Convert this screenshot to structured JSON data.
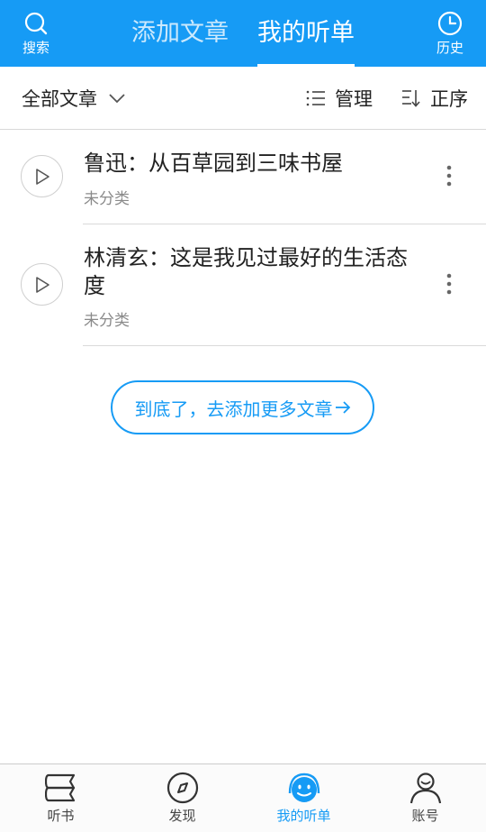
{
  "colors": {
    "brand": "#169bf5",
    "text": "#222222",
    "muted": "#8a8a8a",
    "divider": "#d9d9d9"
  },
  "header": {
    "search": {
      "label": "搜索",
      "icon": "search-icon"
    },
    "history": {
      "label": "历史",
      "icon": "clock-icon"
    },
    "tabs": [
      {
        "label": "添加文章",
        "active": false
      },
      {
        "label": "我的听单",
        "active": true
      }
    ]
  },
  "toolbar": {
    "filter_label": "全部文章",
    "manage_label": "管理",
    "order_label": "正序"
  },
  "articles": [
    {
      "title": "鲁迅：从百草园到三味书屋",
      "category": "未分类"
    },
    {
      "title": "林清玄：这是我见过最好的生活态度",
      "category": "未分类"
    }
  ],
  "end_button_label": "到底了，去添加更多文章",
  "bottom_nav": [
    {
      "label": "听书",
      "icon": "book-stack-icon",
      "active": false
    },
    {
      "label": "发现",
      "icon": "compass-icon",
      "active": false
    },
    {
      "label": "我的听单",
      "icon": "smiley-headphones-icon",
      "active": true
    },
    {
      "label": "账号",
      "icon": "user-icon",
      "active": false
    }
  ]
}
